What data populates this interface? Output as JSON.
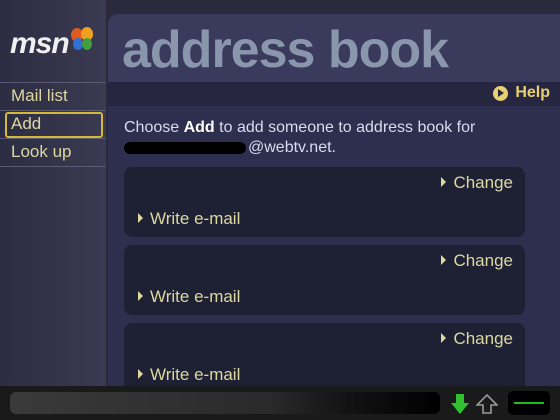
{
  "brand": {
    "logo_text": "msn"
  },
  "sidebar": {
    "items": [
      {
        "label": "Mail list"
      },
      {
        "label": "Add",
        "selected": true
      },
      {
        "label": "Look up"
      }
    ]
  },
  "page": {
    "title": "address book",
    "help_label": "Help",
    "instruction": {
      "prefix": "Choose ",
      "action": "Add",
      "suffix": " to add someone to address book for",
      "email_domain": "@webtv.net."
    }
  },
  "entries": [
    {
      "change_label": "Change",
      "write_label": "Write e-mail"
    },
    {
      "change_label": "Change",
      "write_label": "Write e-mail"
    },
    {
      "change_label": "Change",
      "write_label": "Write e-mail"
    }
  ],
  "colors": {
    "accent": "#dcd8a0",
    "selection": "#d4b838",
    "help": "#e8d070",
    "status_green": "#18c018"
  }
}
